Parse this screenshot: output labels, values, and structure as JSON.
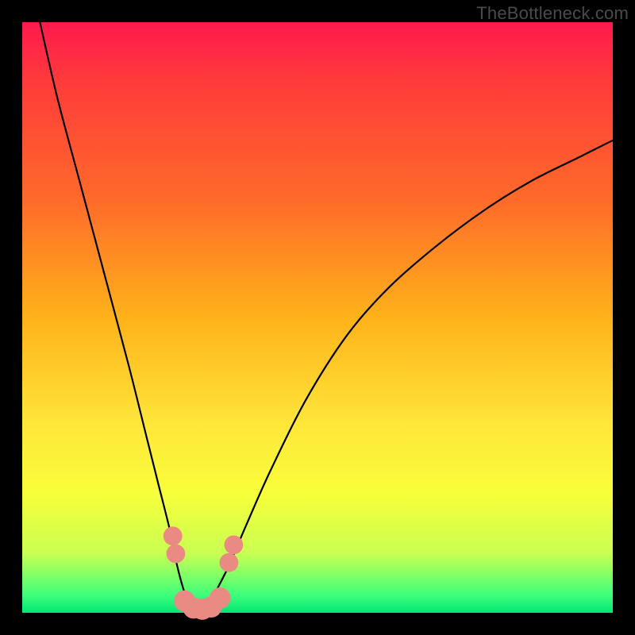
{
  "watermark": "TheBottleneck.com",
  "chart_data": {
    "type": "line",
    "title": "",
    "xlabel": "",
    "ylabel": "",
    "xlim": [
      0,
      100
    ],
    "ylim": [
      0,
      100
    ],
    "series": [
      {
        "name": "curve",
        "color": "#000000",
        "x": [
          3,
          6,
          10,
          14,
          18,
          21,
          23,
          25,
          26,
          27,
          28,
          29,
          30,
          31,
          32,
          33,
          35,
          38,
          42,
          48,
          55,
          62,
          70,
          78,
          86,
          94,
          100
        ],
        "y": [
          100,
          87,
          72,
          57,
          42,
          30,
          22,
          14,
          9,
          5,
          2,
          0.5,
          0,
          0.5,
          2,
          4,
          8,
          15,
          24,
          36,
          47,
          55,
          62,
          68,
          73,
          77,
          80
        ]
      }
    ],
    "markers": [
      {
        "name": "left-cluster-upper",
        "x": 25.5,
        "y": 13,
        "r": 1.6,
        "color": "#e98b83"
      },
      {
        "name": "left-cluster-lower",
        "x": 26.0,
        "y": 10,
        "r": 1.6,
        "color": "#e98b83"
      },
      {
        "name": "bottom-left",
        "x": 27.5,
        "y": 2.0,
        "r": 1.8,
        "color": "#e98b83"
      },
      {
        "name": "bottom-mid-1",
        "x": 29.0,
        "y": 0.8,
        "r": 1.8,
        "color": "#e98b83"
      },
      {
        "name": "bottom-mid-2",
        "x": 30.5,
        "y": 0.6,
        "r": 1.8,
        "color": "#e98b83"
      },
      {
        "name": "bottom-mid-3",
        "x": 32.0,
        "y": 1.0,
        "r": 1.8,
        "color": "#e98b83"
      },
      {
        "name": "bottom-right",
        "x": 33.5,
        "y": 2.5,
        "r": 1.8,
        "color": "#e98b83"
      },
      {
        "name": "right-cluster-lower",
        "x": 35.0,
        "y": 8.5,
        "r": 1.6,
        "color": "#e98b83"
      },
      {
        "name": "right-cluster-upper",
        "x": 35.8,
        "y": 11.5,
        "r": 1.6,
        "color": "#e98b83"
      }
    ]
  }
}
